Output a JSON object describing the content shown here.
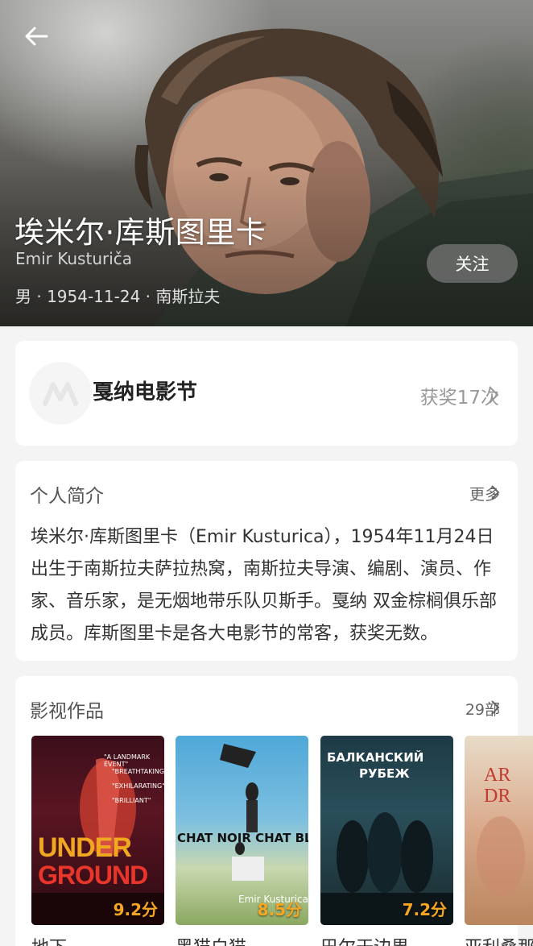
{
  "header": {
    "name": "埃米尔·库斯图里卡",
    "name_en": "Emir Kusturiča",
    "meta": "男 · 1954-11-24 · 南斯拉夫",
    "follow_label": "关注"
  },
  "award": {
    "title": "戛纳电影节",
    "count": "获奖17次"
  },
  "bio": {
    "title": "个人简介",
    "more": "更多",
    "text": "埃米尔·库斯图里卡（Emir Kusturica），1954年11月24日出生于南斯拉夫萨拉热窝，南斯拉夫导演、编剧、演员、作家、音乐家，是无烟地带乐队贝斯手。戛纳 双金棕榈俱乐部成员。库斯图里卡是各大电影节的常客，获奖无数。"
  },
  "works": {
    "title": "影视作品",
    "count": "29部",
    "items": [
      {
        "title": "地下",
        "score": "9.2分",
        "poster_top": "UNDER",
        "poster_bottom": "GROUND",
        "q1": "\"A LANDMARK EVENT\"",
        "q2": "\"BREATHTAKING\"",
        "q3": "\"EXHILARATING\"",
        "q4": "\"BRILLIANT\""
      },
      {
        "title": "黑猫白猫",
        "score": "8.5分",
        "poster_text": "CHAT NOIR CHAT BLANC",
        "poster_credit": "Emir Kusturica"
      },
      {
        "title": "巴尔干边界",
        "score": "7.2分",
        "poster_line1": "БАЛКАНСКИЙ",
        "poster_line2": "РУБЕЖ"
      },
      {
        "title": "亚利桑那之梦",
        "score": "",
        "poster_text": "AR DR"
      }
    ]
  },
  "colors": {
    "accent_score": "#f6a623",
    "follow_bg": "rgba(115,115,115,0.78)"
  }
}
